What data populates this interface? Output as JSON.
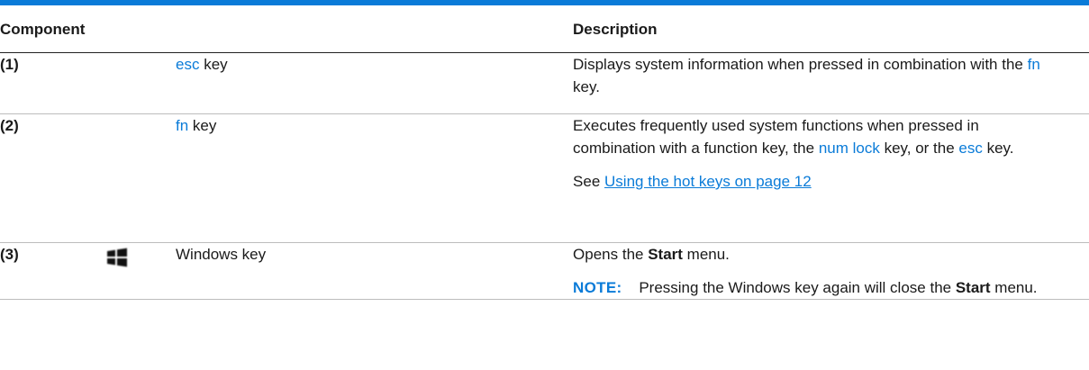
{
  "table": {
    "headers": {
      "component": "Component",
      "description": "Description"
    },
    "rows": [
      {
        "number": "(1)",
        "name_key": "esc",
        "name_suffix": " key",
        "description": {
          "line_pre": "Displays system information when pressed in combination with the ",
          "key": "fn",
          "line_post": " key."
        }
      },
      {
        "number": "(2)",
        "name_key": "fn",
        "name_suffix": " key",
        "description": {
          "pre": "Executes frequently used system functions when pressed in combination with a function key, the ",
          "key1": "num lock",
          "mid": " key, or the ",
          "key2": "esc",
          "post": " key.",
          "see_prefix": "See ",
          "see_link": "Using the hot keys on page 12"
        }
      },
      {
        "number": "(3)",
        "icon": "windows-logo-icon",
        "name": "Windows key",
        "description": {
          "pre": "Opens the ",
          "bold": "Start",
          "post": " menu.",
          "note_label": "NOTE:",
          "note_pre": "Pressing the Windows key again will close the ",
          "note_bold": "Start",
          "note_post": " menu."
        }
      }
    ]
  },
  "colors": {
    "accent": "#0a7bd8"
  }
}
